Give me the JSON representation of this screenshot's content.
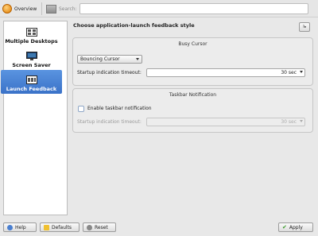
{
  "toolbar": {
    "overview_label": "Overview",
    "search_label": "Search:",
    "search_value": ""
  },
  "sidebar": {
    "items": [
      {
        "label": "Multiple Desktops",
        "icon": "desktops-icon"
      },
      {
        "label": "Screen Saver",
        "icon": "monitor-icon"
      },
      {
        "label": "Launch Feedback",
        "icon": "launch-feedback-icon",
        "active": true
      }
    ]
  },
  "main": {
    "title": "Choose application-launch feedback style",
    "busy_cursor": {
      "legend": "Busy Cursor",
      "style_value": "Bouncing Cursor",
      "timeout_label": "Startup indication timeout:",
      "timeout_value": "30 sec"
    },
    "taskbar": {
      "legend": "Taskbar Notification",
      "enable_label": "Enable taskbar notification",
      "enabled": false,
      "timeout_label": "Startup indication timeout:",
      "timeout_value": "30 sec"
    }
  },
  "buttons": {
    "help": "Help",
    "defaults": "Defaults",
    "reset": "Reset",
    "apply": "Apply"
  },
  "colors": {
    "accent": "#3a72c8",
    "apply_icon": "#3a9a2a"
  }
}
